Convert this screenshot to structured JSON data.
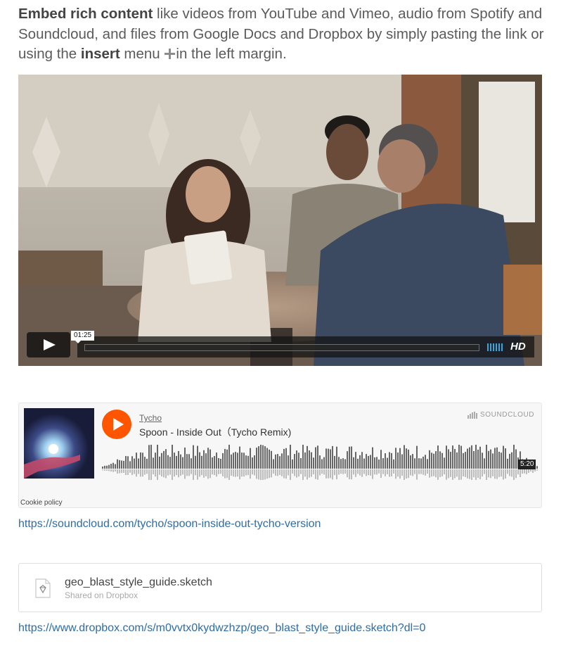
{
  "intro": {
    "bold_lead": "Embed rich content",
    "text_1": " like videos from YouTube and Vimeo, audio from Spotify and Soundcloud, and files from Google Docs and Dropbox by simply pasting the link or using the ",
    "bold_insert": "insert",
    "text_2": " menu ",
    "icon": "plus-icon",
    "text_3": "in the left margin."
  },
  "video": {
    "current_time": "01:25",
    "progress": 0.0,
    "hd_label": "HD",
    "icons": [
      "play-icon",
      "volume-icon"
    ]
  },
  "soundcloud": {
    "artist": "Tycho",
    "track": "Spoon - Inside Out（Tycho Remix)",
    "brand": "SOUNDCLOUD",
    "duration": "5:20",
    "cookie_policy": "Cookie policy",
    "accent_color": "#ff5500"
  },
  "soundcloud_link": "https://soundcloud.com/tycho/spoon-inside-out-tycho-version",
  "dropbox": {
    "filename": "geo_blast_style_guide.sketch",
    "subtitle": "Shared on Dropbox",
    "icon": "sketch-file-icon"
  },
  "dropbox_link": "https://www.dropbox.com/s/m0vvtx0kydwzhzp/geo_blast_style_guide.sketch?dl=0",
  "colors": {
    "link": "#2e6da4",
    "hd_volume": "#3fa3d6"
  }
}
